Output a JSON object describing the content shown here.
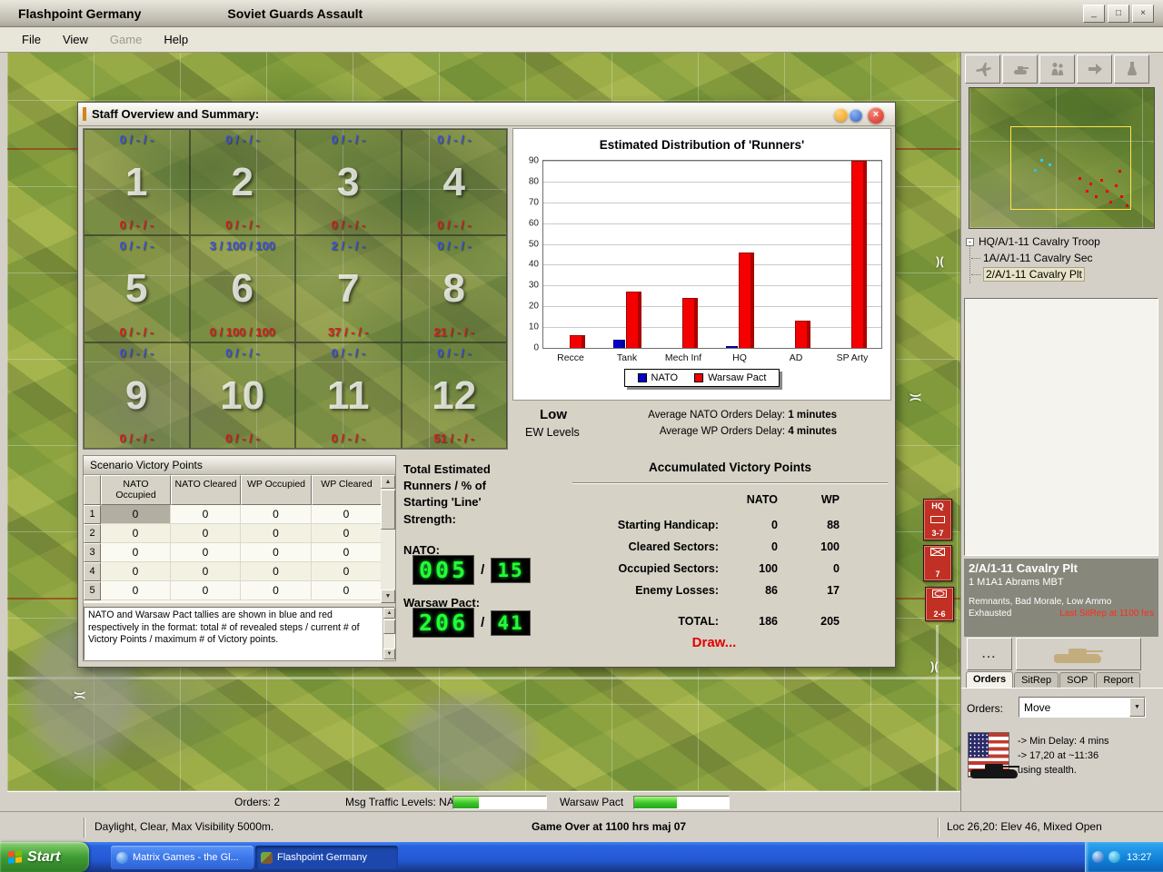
{
  "window": {
    "title": "Flashpoint Germany",
    "scenario": "Soviet Guards Assault"
  },
  "icons": {
    "min": "_",
    "restore": "□",
    "close": "×",
    "up": "▲",
    "down": "▼",
    "dropdown": "▼",
    "bridge": ")(",
    "minus": "-",
    "dots": "..."
  },
  "menu": {
    "file": "File",
    "view": "View",
    "game": "Game",
    "help": "Help"
  },
  "dialog": {
    "title": "Staff Overview and Summary:",
    "sectors": [
      {
        "num": "1",
        "nato": "0 / - / -",
        "wp": "0 / - / -"
      },
      {
        "num": "2",
        "nato": "0 / - / -",
        "wp": "0 / - / -"
      },
      {
        "num": "3",
        "nato": "0 / - / -",
        "wp": "0 / - / -"
      },
      {
        "num": "4",
        "nato": "0 / - / -",
        "wp": "0 / - / -"
      },
      {
        "num": "5",
        "nato": "0 / - / -",
        "wp": "0 / - / -"
      },
      {
        "num": "6",
        "nato": "3 / 100 / 100",
        "wp": "0 / 100 / 100"
      },
      {
        "num": "7",
        "nato": "2 / - / -",
        "wp": "37 / - / -"
      },
      {
        "num": "8",
        "nato": "0 / - / -",
        "wp": "21 / - / -"
      },
      {
        "num": "9",
        "nato": "0 / - / -",
        "wp": "0 / - / -"
      },
      {
        "num": "10",
        "nato": "0 / - / -",
        "wp": "0 / - / -"
      },
      {
        "num": "11",
        "nato": "0 / - / -",
        "wp": "0 / - / -"
      },
      {
        "num": "12",
        "nato": "0 / - / -",
        "wp": "51 / - / -"
      }
    ],
    "ew": {
      "level": "Low",
      "label": "EW Levels",
      "nato_line": "Average NATO Orders Delay:",
      "nato_value": "1 minutes",
      "wp_line": "Average WP Orders Delay:",
      "wp_value": "4 minutes"
    },
    "svp": {
      "title": "Scenario Victory Points",
      "columns": [
        "NATO Occupied",
        "NATO Cleared",
        "WP Occupied",
        "WP Cleared"
      ],
      "rows": [
        [
          "1",
          "0",
          "0",
          "0",
          "0"
        ],
        [
          "2",
          "0",
          "0",
          "0",
          "0"
        ],
        [
          "3",
          "0",
          "0",
          "0",
          "0"
        ],
        [
          "4",
          "0",
          "0",
          "0",
          "0"
        ],
        [
          "5",
          "0",
          "0",
          "0",
          "0"
        ]
      ],
      "note": "NATO and Warsaw Pact tallies are shown in blue and red respectively in the format: total # of revealed steps / current # of Victory Points / maximum # of Victory points."
    },
    "runners": {
      "title": "Total Estimated Runners / % of Starting 'Line' Strength:",
      "nato_label": "NATO:",
      "nato_total": "005",
      "sep": "/",
      "nato_pct": "15",
      "wp_label": "Warsaw Pact:",
      "wp_total": "206",
      "wp_pct": "41"
    },
    "avp": {
      "title": "Accumulated Victory Points",
      "col_nato": "NATO",
      "col_wp": "WP",
      "rows": [
        {
          "label": "Starting Handicap:",
          "nato": "0",
          "wp": "88"
        },
        {
          "label": "Cleared Sectors:",
          "nato": "0",
          "wp": "100"
        },
        {
          "label": "Occupied Sectors:",
          "nato": "100",
          "wp": "0"
        },
        {
          "label": "Enemy Losses:",
          "nato": "86",
          "wp": "17"
        }
      ],
      "total_label": "TOTAL:",
      "total_nato": "186",
      "total_wp": "205",
      "result": "Draw..."
    }
  },
  "chart_data": {
    "type": "bar",
    "title": "Estimated Distribution of 'Runners'",
    "categories": [
      "Recce",
      "Tank",
      "Mech Inf",
      "HQ",
      "AD",
      "SP Arty"
    ],
    "series": [
      {
        "name": "NATO",
        "color": "#0202c8",
        "values": [
          0,
          4,
          0,
          1,
          0,
          0
        ]
      },
      {
        "name": "Warsaw Pact",
        "color": "#f40000",
        "values": [
          6,
          27,
          24,
          46,
          13,
          90
        ]
      }
    ],
    "ylim": [
      0,
      90
    ],
    "ytick_step": 10,
    "grid": true,
    "legend_position": "bottom"
  },
  "map": {
    "counters": [
      {
        "top": "HQ",
        "bottom": "3-7"
      },
      {
        "top": "",
        "bottom": "7"
      },
      {
        "top": "",
        "bottom": "2-6"
      }
    ]
  },
  "sidebar": {
    "tree": {
      "root": "HQ/A/1-11 Cavalry Troop",
      "children": [
        "1A/A/1-11 Cavalry Sec",
        "2/A/1-11 Cavalry Plt"
      ]
    },
    "unit": {
      "name": "2/A/1-11 Cavalry Plt",
      "type": "1 M1A1 Abrams MBT",
      "status1": "Remnants, Bad Morale, Low Ammo",
      "status2": "Exhausted",
      "sitrep": "Last SitRep at 1100 hrs"
    },
    "tabs": [
      "Orders",
      "SitRep",
      "SOP",
      "Report"
    ],
    "orders_label": "Orders:",
    "orders_value": "Move",
    "delay_lines": [
      "-> Min Delay: 4 mins",
      "-> 17,20 at ~11:36",
      "using stealth."
    ]
  },
  "bottombar": {
    "orders": "Orders: 2",
    "msg_label": "Msg Traffic Levels: NATO",
    "wp_label": "Warsaw Pact",
    "nato_level_pct": 27,
    "wp_level_pct": 45
  },
  "statusbar": {
    "left": "Daylight, Clear, Max Visibility 5000m.",
    "center": "Game Over at 1100 hrs maj 07",
    "right": "Loc 26,20: Elev 46, Mixed Open"
  },
  "taskbar": {
    "start": "Start",
    "buttons": [
      "Matrix Games - the Gl...",
      "Flashpoint Germany"
    ],
    "time": "13:27"
  }
}
